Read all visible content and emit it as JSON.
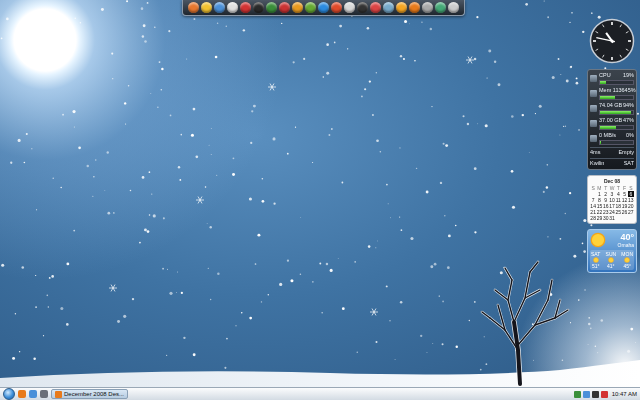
{
  "clock": {
    "hour_hand": 0.9,
    "minute_hand": 0.783
  },
  "cpu_meter": {
    "rows": [
      {
        "label": "CPU",
        "reading": "19%",
        "level": 0.19
      },
      {
        "label": "Mem 1136",
        "reading": "45%",
        "level": 0.45
      },
      {
        "label": "74.04 GB",
        "reading": "94%",
        "level": 0.94
      },
      {
        "label": "37.00 GB",
        "reading": "47%",
        "level": 0.47
      },
      {
        "label": "0 MB/s",
        "reading": "0%",
        "level": 0.02
      }
    ],
    "footer": [
      {
        "label": "4ms",
        "reading": "Empty"
      },
      {
        "label": "Kwilin",
        "reading": "SAT"
      }
    ]
  },
  "calendar": {
    "month": "Dec 08",
    "weekdays": [
      "S",
      "M",
      "T",
      "W",
      "T",
      "F",
      "S"
    ],
    "weeks": [
      [
        {
          "day": "1",
          "selected": false
        },
        {
          "day": "2",
          "selected": false
        },
        {
          "day": "3",
          "selected": false
        },
        {
          "day": "4",
          "selected": false
        },
        {
          "day": "5",
          "selected": false
        },
        {
          "day": "6",
          "selected": true
        }
      ],
      [
        {
          "day": "7",
          "selected": false
        },
        {
          "day": "8",
          "selected": false
        },
        {
          "day": "9",
          "selected": false
        },
        {
          "day": "10",
          "selected": false
        },
        {
          "day": "11",
          "selected": false
        },
        {
          "day": "12",
          "selected": false
        },
        {
          "day": "13",
          "selected": false
        }
      ],
      [
        {
          "day": "14",
          "selected": false
        },
        {
          "day": "15",
          "selected": false
        },
        {
          "day": "16",
          "selected": false
        },
        {
          "day": "17",
          "selected": false
        },
        {
          "day": "18",
          "selected": false
        },
        {
          "day": "19",
          "selected": false
        },
        {
          "day": "20",
          "selected": false
        }
      ],
      [
        {
          "day": "21",
          "selected": false
        },
        {
          "day": "22",
          "selected": false
        },
        {
          "day": "23",
          "selected": false
        },
        {
          "day": "24",
          "selected": false
        },
        {
          "day": "25",
          "selected": false
        },
        {
          "day": "26",
          "selected": false
        },
        {
          "day": "27",
          "selected": false
        }
      ],
      [
        {
          "day": "28",
          "selected": false
        },
        {
          "day": "29",
          "selected": false
        },
        {
          "day": "30",
          "selected": false
        },
        {
          "day": "31",
          "selected": false
        }
      ]
    ]
  },
  "weather": {
    "temp": "40°",
    "city": "Omaha",
    "forecast": [
      {
        "day": "SAT",
        "temp": "51°"
      },
      {
        "day": "SUN",
        "temp": "41°"
      },
      {
        "day": "MON",
        "temp": "45°"
      }
    ]
  },
  "taskbar": {
    "tasks": [
      {
        "label": "December 2008 Des...",
        "selected": true
      }
    ],
    "clock": "10:47 AM"
  }
}
